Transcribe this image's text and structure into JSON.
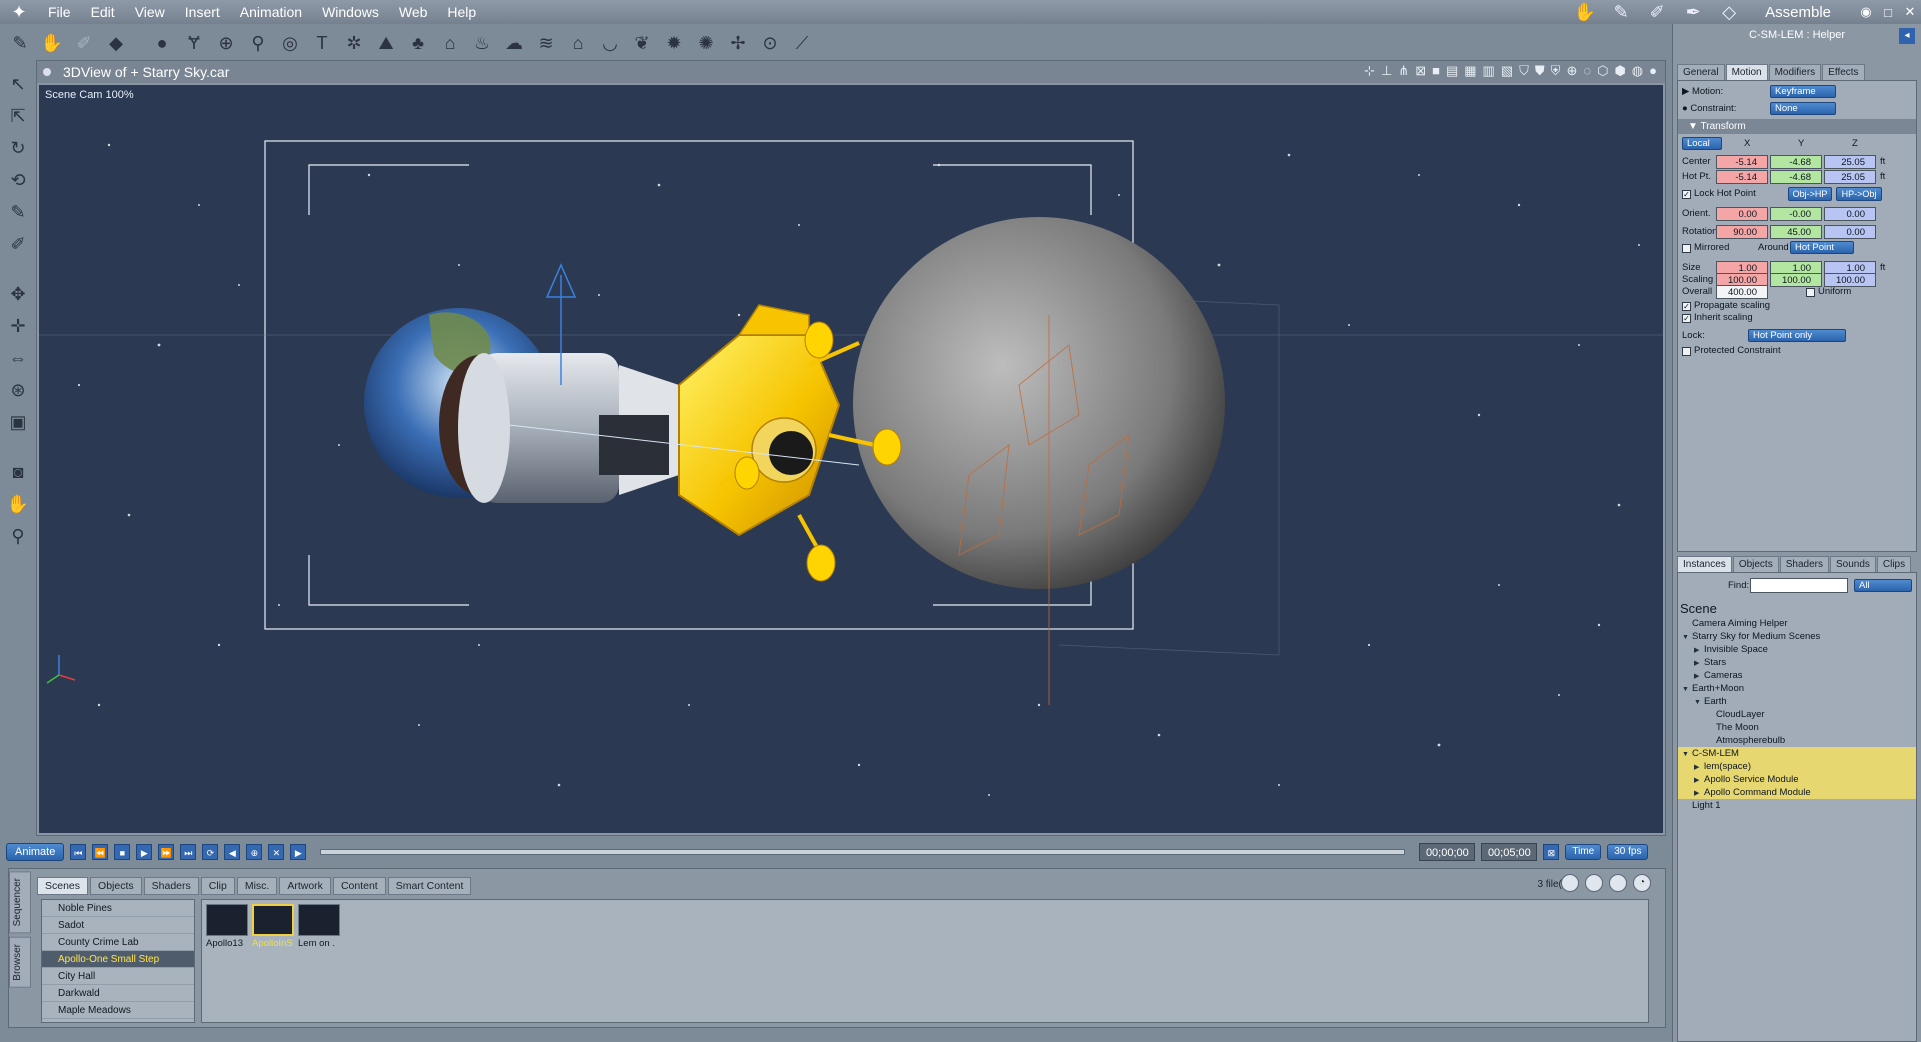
{
  "menubar": {
    "items": [
      "File",
      "Edit",
      "View",
      "Insert",
      "Animation",
      "Windows",
      "Web",
      "Help"
    ],
    "room_label": "Assemble",
    "window_buttons": [
      "◉",
      "□",
      "✕"
    ]
  },
  "viewport": {
    "title": "3DView of +  Starry Sky.car",
    "camera_label": "Scene Cam 100%"
  },
  "timeline": {
    "animate_label": "Animate",
    "current_time": "00;00;00",
    "end_time": "00;05;00",
    "time_mode": "Time",
    "fps": "30 fps"
  },
  "browser": {
    "side_tabs": [
      "Sequencer",
      "Browser"
    ],
    "tabs": [
      "Scenes",
      "Objects",
      "Shaders",
      "Clip",
      "Misc.",
      "Artwork",
      "Content",
      "Smart Content"
    ],
    "active_tab": "Scenes",
    "file_count": "3 file(s).",
    "list": [
      "Noble Pines",
      "Sadot",
      "County Crime Lab",
      "Apollo-One Small Step",
      "City Hall",
      "Darkwald",
      "Maple Meadows"
    ],
    "selected_list_item": "Apollo-One Small Step",
    "thumbnails": [
      {
        "caption": "Apollo13"
      },
      {
        "caption": "ApolloInS"
      },
      {
        "caption": "Lem on ."
      }
    ]
  },
  "panel": {
    "title": "C-SM-LEM : Helper",
    "tabs": [
      "General",
      "Motion",
      "Modifiers",
      "Effects"
    ],
    "active_tab": "Motion",
    "motion_label": "Motion:",
    "motion_value": "Keyframe",
    "constraint_label": "Constraint:",
    "constraint_value": "None",
    "transform_label": "Transform",
    "space": "Local",
    "axes": [
      "X",
      "Y",
      "Z"
    ],
    "center_label": "Center",
    "center": [
      "-5.14",
      "-4.68",
      "25.05"
    ],
    "hotpt_label": "Hot Pt.",
    "hotpt": [
      "-5.14",
      "-4.68",
      "25.05"
    ],
    "unit": "ft",
    "lock_hot_point": "Lock Hot Point",
    "obj_hp": "Obj->HP",
    "hp_obj": "HP->Obj",
    "orient_label": "Orient.",
    "orient": [
      "0.00",
      "-0.00",
      "0.00"
    ],
    "rotation_label": "Rotation",
    "rotation": [
      "90.00",
      "45.00",
      "0.00"
    ],
    "mirrored": "Mirrored",
    "around_label": "Around",
    "around_value": "Hot Point",
    "size_label": "Size",
    "size": [
      "1.00",
      "1.00",
      "1.00"
    ],
    "scaling_label": "Scaling",
    "scaling": [
      "100.00",
      "100.00",
      "100.00"
    ],
    "overall_label": "Overall",
    "overall": "400.00",
    "uniform": "Uniform",
    "propagate_scaling": "Propagate scaling",
    "inherit_scaling": "Inherit scaling",
    "lock_label": "Lock:",
    "lock_value": "Hot Point only",
    "protected_constraint": "Protected Constraint"
  },
  "instances": {
    "tabs": [
      "Instances",
      "Objects",
      "Shaders",
      "Sounds",
      "Clips"
    ],
    "active_tab": "Instances",
    "find_label": "Find:",
    "find_value": "",
    "filter_value": "All",
    "tree_title": "Scene",
    "tree": [
      {
        "label": "Camera Aiming Helper",
        "level": 0,
        "tri": "",
        "hl": false
      },
      {
        "label": "Starry Sky for Medium Scenes",
        "level": 0,
        "tri": "▼",
        "hl": false
      },
      {
        "label": "Invisible Space",
        "level": 1,
        "tri": "▶",
        "hl": false
      },
      {
        "label": "Stars",
        "level": 1,
        "tri": "▶",
        "hl": false
      },
      {
        "label": "Cameras",
        "level": 1,
        "tri": "▶",
        "hl": false
      },
      {
        "label": "Earth+Moon",
        "level": 0,
        "tri": "▼",
        "hl": false
      },
      {
        "label": "Earth",
        "level": 1,
        "tri": "▼",
        "hl": false
      },
      {
        "label": "CloudLayer",
        "level": 2,
        "tri": "",
        "hl": false
      },
      {
        "label": "The Moon",
        "level": 2,
        "tri": "",
        "hl": false
      },
      {
        "label": "Atmospherebulb",
        "level": 2,
        "tri": "",
        "hl": false
      },
      {
        "label": "C-SM-LEM",
        "level": 0,
        "tri": "▼",
        "hl": true
      },
      {
        "label": "lem(space)",
        "level": 1,
        "tri": "▶",
        "hl": true
      },
      {
        "label": "Apollo Service Module",
        "level": 1,
        "tri": "▶",
        "hl": true
      },
      {
        "label": "Apollo Command Module",
        "level": 1,
        "tri": "▶",
        "hl": true
      },
      {
        "label": "Light 1",
        "level": 0,
        "tri": "",
        "hl": false
      }
    ]
  },
  "colors": {
    "scene_bg": "#2b3a52",
    "accent_blue": "#2f63ad",
    "lem_gold": "#f6c400",
    "highlight_yellow": "#e6d770"
  }
}
